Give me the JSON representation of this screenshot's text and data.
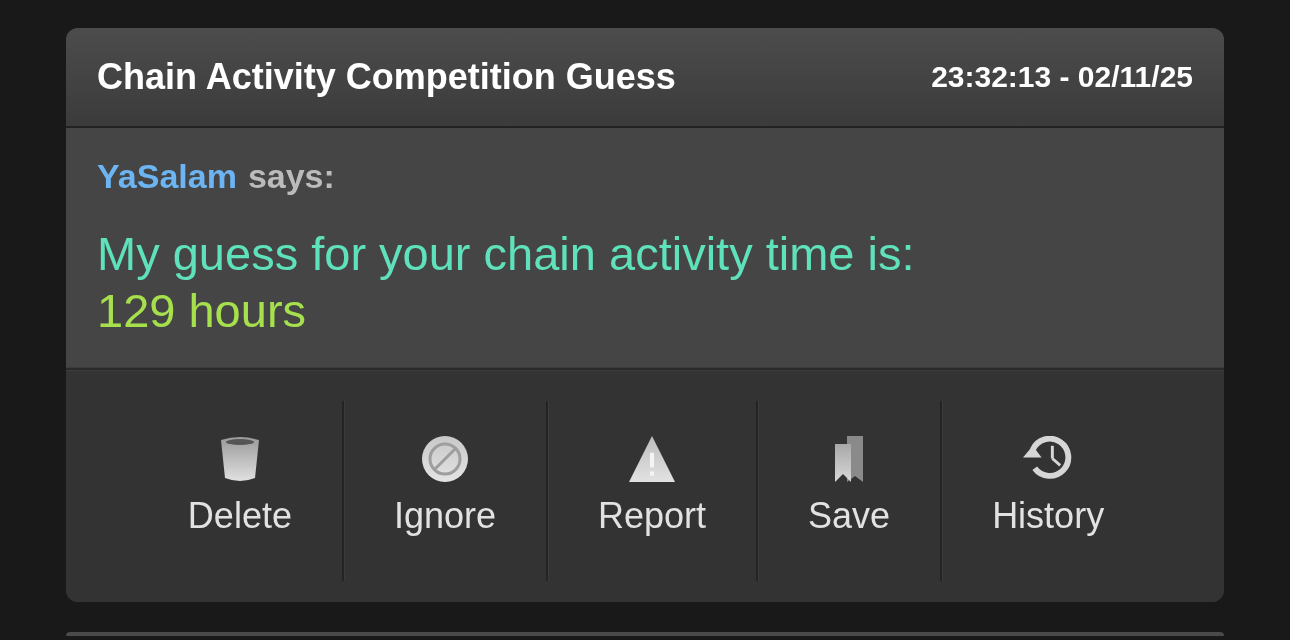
{
  "post": {
    "title": "Chain Activity Competition Guess",
    "timestamp": "23:32:13 - 02/11/25",
    "author": "YaSalam",
    "says_label": "says:",
    "message": "My guess for your chain activity time is:",
    "guess": "129 hours"
  },
  "actions": [
    {
      "label": "Delete",
      "kind": "delete"
    },
    {
      "label": "Ignore",
      "kind": "ignore"
    },
    {
      "label": "Report",
      "kind": "report"
    },
    {
      "label": "Save",
      "kind": "save"
    },
    {
      "label": "History",
      "kind": "history"
    }
  ]
}
